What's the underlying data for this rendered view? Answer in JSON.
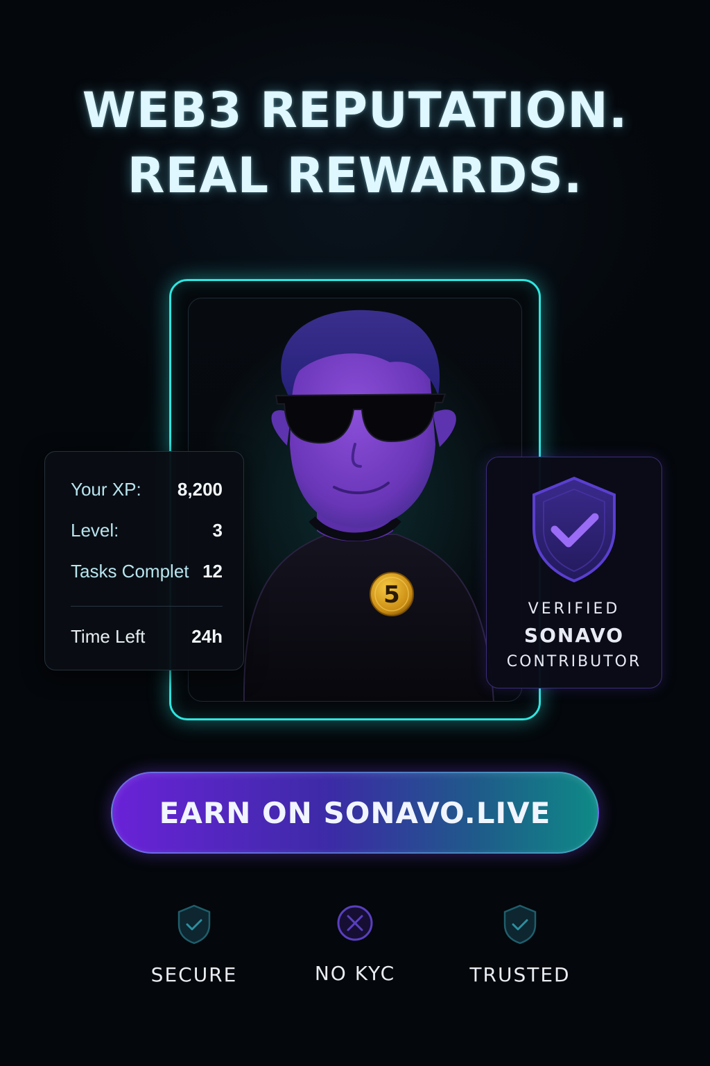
{
  "headline": {
    "line1": "WEB3 REPUTATION.",
    "line2": "REAL REWARDS."
  },
  "colors": {
    "accent_teal": "#2ee6e0",
    "accent_purple": "#6a22d8",
    "background": "#04070b",
    "coin_gold": "#d9a21e"
  },
  "avatar": {
    "description_icon": "avatar-character",
    "coin_badge": "5"
  },
  "stats": {
    "xp_label": "Your XP:",
    "xp_value": "8,200",
    "level_label": "Level:",
    "level_value": "3",
    "tasks_label": "Tasks Complet",
    "tasks_value": "12",
    "time_label": "Time Left",
    "time_value": "24h"
  },
  "verified": {
    "icon": "shield-check-icon",
    "line1": "VERIFIED",
    "line2": "SONAVO",
    "line3": "CONTRIBUTOR"
  },
  "cta": {
    "label": "EARN ON SONAVO.LIVE"
  },
  "badges": [
    {
      "icon": "shield-check-icon",
      "label": "SECURE"
    },
    {
      "icon": "x-circle-icon",
      "label": "NO KYC"
    },
    {
      "icon": "shield-check-icon",
      "label": "TRUSTED"
    }
  ]
}
